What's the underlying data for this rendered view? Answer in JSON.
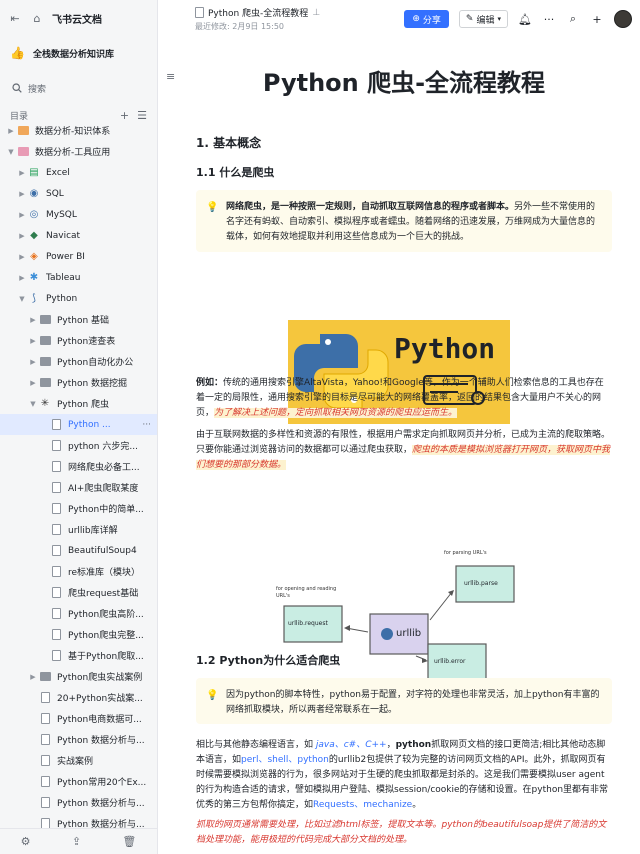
{
  "sidebar": {
    "brand": "飞书云文档",
    "kb_name": "全栈数据分析知识库",
    "search_placeholder": "搜索",
    "toc_label": "目录",
    "tree": [
      {
        "label": "数据分析-知识体系",
        "indent": 1,
        "icon": "folder-orange",
        "expand": "collapsed"
      },
      {
        "label": "数据分析-工具应用",
        "indent": 1,
        "icon": "folder-pink",
        "expand": "expanded"
      },
      {
        "label": "Excel",
        "indent": 2,
        "icon": "excel-icon",
        "expand": "collapsed"
      },
      {
        "label": "SQL",
        "indent": 2,
        "icon": "sql-icon",
        "expand": "collapsed"
      },
      {
        "label": "MySQL",
        "indent": 2,
        "icon": "mysql-icon",
        "expand": "collapsed"
      },
      {
        "label": "Navicat",
        "indent": 2,
        "icon": "navicat-icon",
        "expand": "collapsed"
      },
      {
        "label": "Power BI",
        "indent": 2,
        "icon": "powerbi-icon",
        "expand": "collapsed"
      },
      {
        "label": "Tableau",
        "indent": 2,
        "icon": "tableau-icon",
        "expand": "collapsed"
      },
      {
        "label": "Python",
        "indent": 2,
        "icon": "python-icon",
        "expand": "expanded"
      },
      {
        "label": "Python 基础",
        "indent": 3,
        "icon": "folder",
        "expand": "collapsed"
      },
      {
        "label": "Python速查表",
        "indent": 3,
        "icon": "folder",
        "expand": "collapsed"
      },
      {
        "label": "Python自动化办公",
        "indent": 3,
        "icon": "folder",
        "expand": "collapsed"
      },
      {
        "label": "Python 数据挖掘",
        "indent": 3,
        "icon": "folder",
        "expand": "collapsed"
      },
      {
        "label": "Python 爬虫",
        "indent": 3,
        "icon": "spider-icon",
        "expand": "expanded"
      },
      {
        "label": "Python ...",
        "indent": 4,
        "icon": "doc",
        "expand": "none",
        "active": true
      },
      {
        "label": "python 六步完...",
        "indent": 4,
        "icon": "doc",
        "expand": "none"
      },
      {
        "label": "网络爬虫必备工...",
        "indent": 4,
        "icon": "doc",
        "expand": "none"
      },
      {
        "label": "AI+爬虫爬取某度",
        "indent": 4,
        "icon": "doc",
        "expand": "none"
      },
      {
        "label": "Python中的简单...",
        "indent": 4,
        "icon": "doc",
        "expand": "none"
      },
      {
        "label": "urllib库详解",
        "indent": 4,
        "icon": "doc",
        "expand": "none"
      },
      {
        "label": "BeautifulSoup4",
        "indent": 4,
        "icon": "doc",
        "expand": "none"
      },
      {
        "label": "re标准库（模块）",
        "indent": 4,
        "icon": "doc",
        "expand": "none"
      },
      {
        "label": "爬虫request基础",
        "indent": 4,
        "icon": "doc",
        "expand": "none"
      },
      {
        "label": "Python爬虫高阶...",
        "indent": 4,
        "icon": "doc",
        "expand": "none"
      },
      {
        "label": "Python爬虫完整...",
        "indent": 4,
        "icon": "doc",
        "expand": "none"
      },
      {
        "label": "基于Python爬取...",
        "indent": 4,
        "icon": "doc",
        "expand": "none"
      },
      {
        "label": "Python爬虫实战案例",
        "indent": 3,
        "icon": "folder",
        "expand": "collapsed"
      },
      {
        "label": "20+Python实战案...",
        "indent": 3,
        "icon": "doc",
        "expand": "none"
      },
      {
        "label": "Python电商数据可...",
        "indent": 3,
        "icon": "doc",
        "expand": "none"
      },
      {
        "label": "Python 数据分析与...",
        "indent": 3,
        "icon": "doc",
        "expand": "none"
      },
      {
        "label": "实战案例",
        "indent": 3,
        "icon": "doc",
        "expand": "none"
      },
      {
        "label": "Python常用20个Ex...",
        "indent": 3,
        "icon": "doc",
        "expand": "none"
      },
      {
        "label": "Python 数据分析与...",
        "indent": 3,
        "icon": "doc",
        "expand": "none"
      },
      {
        "label": "Python 数据分析与...",
        "indent": 3,
        "icon": "doc",
        "expand": "none"
      }
    ],
    "active_more": "···"
  },
  "header": {
    "doc_name": "Python 爬虫-全流程教程",
    "modified": "最近修改: 2月9日 15:50",
    "share_label": "分享",
    "edit_label": "编辑"
  },
  "doc": {
    "title": "Python 爬虫-全流程教程",
    "h1_basic": "1. 基本概念",
    "h2_what": "1.1 什么是爬虫",
    "callout1_bold": "网络爬虫，是一种按照一定规则，自动抓取互联网信息的程序或者脚本。",
    "callout1_rest": "另外一些不常使用的名字还有蚂蚁、自动索引、模拟程序或者蠕虫。随着网络的迅速发展，万维网成为大量信息的载体，如何有效地提取并利用这些信息成为一个巨大的挑战。",
    "image_text": "Python",
    "ex_label": "例如：",
    "ex_text": "传统的通用搜索引擎AltaVista，Yahoo!和Google等，作为一个辅助人们检索信息的工具也存在着一定的局限性，通用搜索引擎的目标是尽可能大的网络覆盖率，返回的结果包含大量用户不关心的网页，",
    "ex_em": "为了解决上述问题，定向抓取相关网页资源的爬虫应运而生。",
    "para2_text": "由于互联网数据的多样性和资源的有限性，根据用户需求定向抓取网页并分析，已成为主流的爬取策略。只要你能通过浏览器访问的数据都可以通过爬虫获取，",
    "para2_em": "爬虫的本质是模拟浏览器打开网页，获取网页中我们想要的那部分数据。",
    "diagram": {
      "center": "urllib",
      "left_box": "urllib.request",
      "top_box": "urllib.parse",
      "bottom_box": "urllib.error",
      "note_left": "for opening and reading URL's",
      "note_top": "for parsing URL's"
    },
    "h2_why": "1.2 Python为什么适合爬虫",
    "callout2": "因为python的脚本特性，python易于配置，对字符的处理也非常灵活，加上python有丰富的网络抓取模块，所以两者经常联系在一起。",
    "p3_a": "相比与其他静态编程语言，如 ",
    "p3_langs": "java、c#、C++",
    "p3_b": "，",
    "p3_python": "python",
    "p3_c": "抓取网页文档的接口更简洁;相比其他动态脚本语言，如",
    "p3_perl": "perl、shell、python",
    "p3_d": "的urllib2包提供了较为完整的访问网页文档的API。此外，抓取网页有时候需要模拟浏览器的行为，很多网站对于生硬的爬虫抓取都是封杀的。这是我们需要模拟user agent的行为构造合适的请求，譬如模拟用户登陆、模拟session/cookie的存储和设置。在python里都有非常优秀的第三方包帮你搞定，如",
    "p3_libs": "Requests、mechanize",
    "p3_e": "。",
    "p4_em": "抓取的网页通常需要处理，比如过滤html标签，提取文本等。python的beautifulsoap提供了简洁的文档处理功能，能用极短的代码完成大部分文档的处理。"
  },
  "colors": {
    "accent": "#3370ff",
    "callout_bg": "#fefbec",
    "emphasis_red": "#d83931",
    "python_yellow": "#f5c63d"
  }
}
